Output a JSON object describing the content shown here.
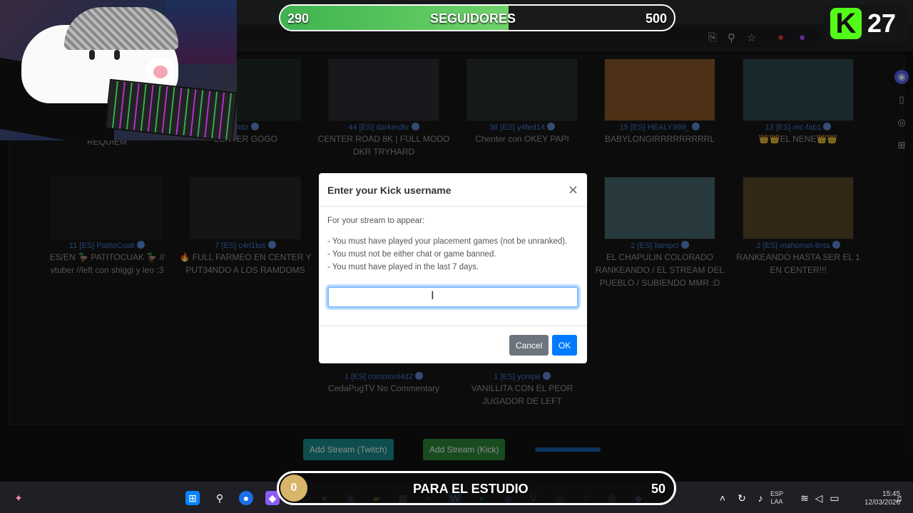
{
  "overlay": {
    "followers": {
      "current": "290",
      "label": "SEGUIDORES",
      "goal": "500",
      "progress": 0.58
    },
    "kick_count": "27",
    "kick_logo": "K",
    "studio": {
      "current": "0",
      "label": "PARA EL ESTUDIO",
      "goal": "50",
      "progress": 0
    }
  },
  "streams_row1": [
    {
      "meta": "",
      "title": "HOT 11PM RESIDENT EVIL REQUIEM",
      "thumb": "#2a2f2a"
    },
    {
      "meta": "chdz",
      "title": "CENTER GOGO",
      "thumb": "#1f2a24"
    },
    {
      "meta": "44 [ES] darkerdkr",
      "title": "CENTER ROAD 8K | FULL MODO DKR TRYHARD",
      "thumb": "#2c2f33"
    },
    {
      "meta": "38 [ES] y4fed14",
      "title": "Chenter con OKEY PAPI",
      "thumb": "#2b3130"
    },
    {
      "meta": "15 [ES] HEALY999_",
      "title": "BABYLONGIRRRRRRRRRL",
      "thumb": "#8a5a2a"
    },
    {
      "meta": "13 [ES] mc-fab1",
      "title": "👑👑EL NENE👑👑",
      "thumb": "#2f4a4f"
    }
  ],
  "streams_row2": [
    {
      "meta": "11 [ES] PatitoCuak",
      "title": "ES/EN 🦆 PATITOCUAK 🦆 // vtuber //left con shiggi y leo :3",
      "thumb": "#1d1f1d"
    },
    {
      "meta": "7 [ES] c4rl1tos",
      "title": "🔥 FULL FARMEO EN CENTER Y PUT34NDO A LOS RAMDOMS",
      "thumb": "#2a2626"
    },
    {
      "meta": "2 [ES] liampci",
      "title": "EL CHAPULIN COLORADO RANKEANDO / EL STREAM DEL PUEBLO / SUBIENDO MMR :D",
      "thumb": "#4a6a70"
    },
    {
      "meta": "2 [ES] mahomet-tinta",
      "title": "RANKEANDO HASTA SER EL 1 EN CENTER!!!",
      "thumb": "#5a4a2a"
    }
  ],
  "streams_row3": [
    {
      "meta": "1 [ES] commonl4d2",
      "title": "CedaPugTV No Commentary"
    },
    {
      "meta": "1 [ES] yonipe",
      "title": "VANILLITA CON EL PEOR JUGADOR DE LEFT"
    }
  ],
  "actions": {
    "add_twitch": "Add Stream (Twitch)",
    "add_kick": "Add Stream (Kick)"
  },
  "modal": {
    "title": "Enter your Kick username",
    "close": "×",
    "intro": "For your stream to appear:",
    "requirements": [
      "- You must have played your placement games (not be unranked).",
      "- You must not be either chat or game banned.",
      "- You must have played in the last 7 days."
    ],
    "input_value": "",
    "cancel": "Cancel",
    "ok": "OK"
  },
  "tray": {
    "lang1": "ESP",
    "lang2": "LAA",
    "time": "15:45",
    "date": "12/03/2026"
  },
  "colors": {
    "twitch_btn": "#1a8f8f",
    "kick_btn": "#2d8a3a",
    "cancel_btn": "#6c757d",
    "ok_btn": "#007bff",
    "kick_green": "#53fc18"
  }
}
